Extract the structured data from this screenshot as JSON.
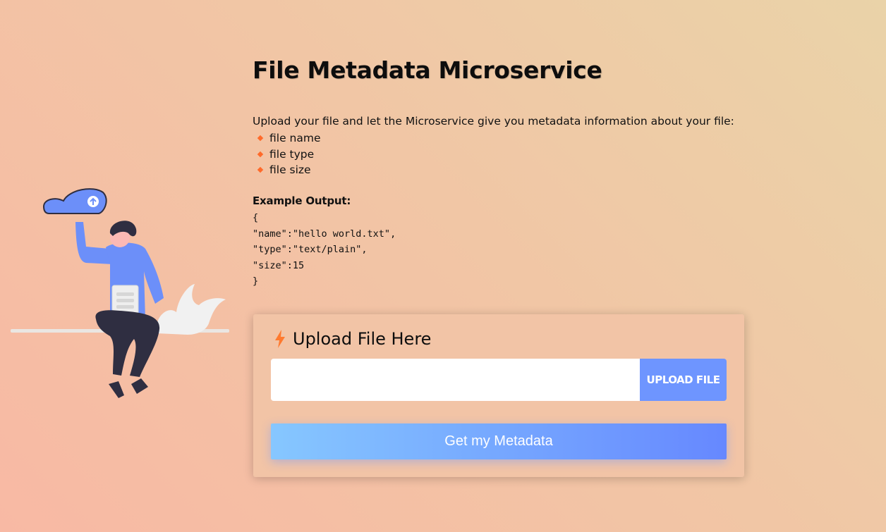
{
  "page": {
    "title": "File Metadata Microservice",
    "intro": "Upload your file and let the Microservice give you metadata information about your file:",
    "features": [
      "file name",
      "file type",
      "file size"
    ],
    "example_heading": "Example Output:",
    "example_code": "{\n\"name\":\"hello world.txt\",\n\"type\":\"text/plain\",\n\"size\":15\n}"
  },
  "upload_card": {
    "title": "Upload File Here",
    "title_icon": "lightning-bolt-icon",
    "file_input_value": "",
    "upload_button_label": "UPLOAD FILE",
    "submit_button_label": "Get my Metadata"
  },
  "colors": {
    "accent_orange": "#ff6a2a",
    "button_blue": "#6e95ff",
    "gradient_start": "#86c7ff",
    "gradient_end": "#6688ff"
  },
  "illustration": {
    "icon": "person-with-cloud-upload-illustration"
  }
}
